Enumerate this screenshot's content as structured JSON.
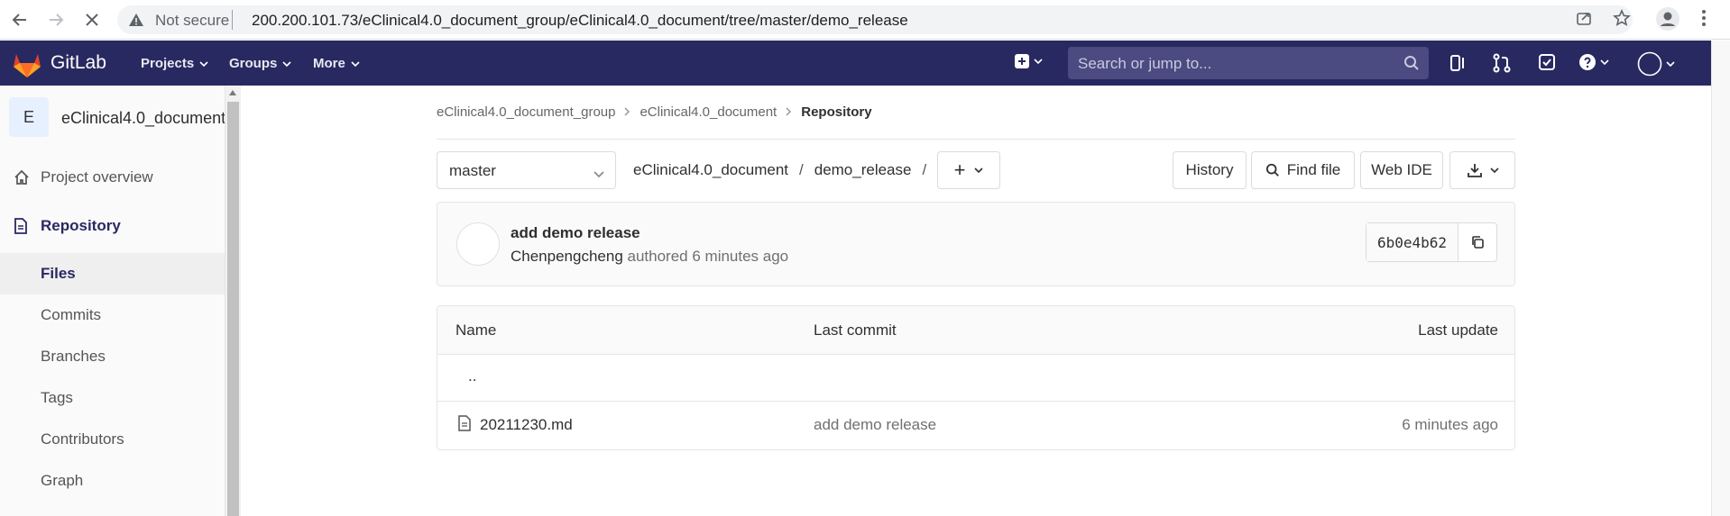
{
  "browser": {
    "not_secure": "Not secure",
    "url": "200.200.101.73/eClinical4.0_document_group/eClinical4.0_document/tree/master/demo_release"
  },
  "navbar": {
    "brand": "GitLab",
    "items": [
      {
        "label": "Projects"
      },
      {
        "label": "Groups"
      },
      {
        "label": "More"
      }
    ],
    "search_placeholder": "Search or jump to..."
  },
  "sidebar": {
    "project_initial": "E",
    "project_name": "eClinical4.0_document",
    "items": [
      {
        "label": "Project overview"
      },
      {
        "label": "Repository"
      },
      {
        "label": "Files"
      },
      {
        "label": "Commits"
      },
      {
        "label": "Branches"
      },
      {
        "label": "Tags"
      },
      {
        "label": "Contributors"
      },
      {
        "label": "Graph"
      }
    ]
  },
  "breadcrumb": {
    "group": "eClinical4.0_document_group",
    "project": "eClinical4.0_document",
    "current": "Repository"
  },
  "toolbar": {
    "branch": "master",
    "path_root": "eClinical4.0_document",
    "path_folder": "demo_release",
    "path_sep": "/",
    "add_label": "+",
    "history": "History",
    "find_file": "Find file",
    "web_ide": "Web IDE"
  },
  "commit": {
    "title": "add demo release",
    "author": "Chenpengcheng",
    "meta": "authored 6 minutes ago",
    "sha": "6b0e4b62"
  },
  "table": {
    "headers": {
      "name": "Name",
      "last_commit": "Last commit",
      "last_update": "Last update"
    },
    "parent": "..",
    "rows": [
      {
        "name": "20211230.md",
        "last_commit": "add demo release",
        "last_update": "6 minutes ago"
      }
    ]
  },
  "colors": {
    "navbar": "#292961",
    "search_bg": "#4b4b82",
    "accent": "#292961"
  }
}
